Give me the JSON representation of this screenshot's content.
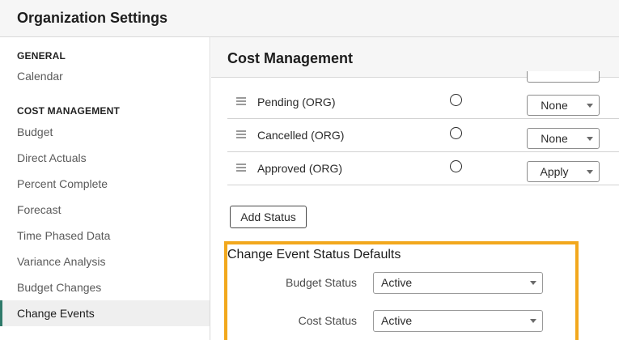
{
  "app_title": "Organization Settings",
  "sidebar": {
    "groups": [
      {
        "heading": "GENERAL",
        "items": [
          {
            "label": "Calendar"
          }
        ]
      },
      {
        "heading": "COST MANAGEMENT",
        "items": [
          {
            "label": "Budget"
          },
          {
            "label": "Direct Actuals"
          },
          {
            "label": "Percent Complete"
          },
          {
            "label": "Forecast"
          },
          {
            "label": "Time Phased Data"
          },
          {
            "label": "Variance Analysis"
          },
          {
            "label": "Budget Changes"
          },
          {
            "label": "Change Events",
            "active": true
          }
        ]
      }
    ]
  },
  "main": {
    "title": "Cost Management",
    "status_rows": [
      {
        "label": "Pending (ORG)",
        "option": "None"
      },
      {
        "label": "Cancelled (ORG)",
        "option": "None"
      },
      {
        "label": "Approved (ORG)",
        "option": "Apply"
      }
    ],
    "add_status_label": "Add Status",
    "defaults": {
      "title": "Change Event Status Defaults",
      "budget_status_label": "Budget Status",
      "budget_status_value": "Active",
      "cost_status_label": "Cost Status",
      "cost_status_value": "Active"
    }
  },
  "colors": {
    "highlight": "#f2a81d",
    "active_indicator": "#2f7a6a"
  }
}
